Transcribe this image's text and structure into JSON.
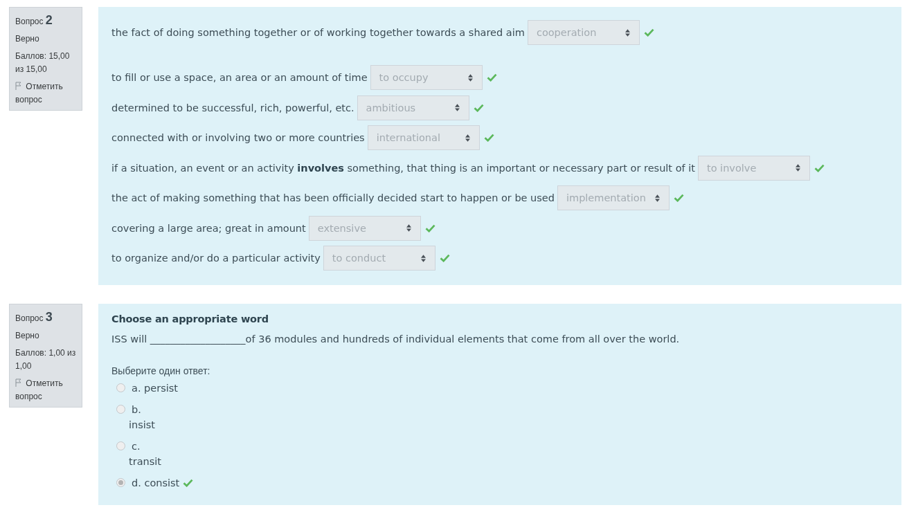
{
  "questions": [
    {
      "label": "Вопрос",
      "number": "2",
      "state": "Верно",
      "grade": "Баллов: 15,00 из 15,00",
      "flag_label": "Отметить вопрос",
      "kind": "matching",
      "disabled": true,
      "rows": [
        {
          "prompt": "the fact of doing something together or of working together towards a shared aim",
          "value": "cooperation",
          "correct": true
        },
        {
          "prompt": "to fill or use a space, an area or an amount of time",
          "value": "to occupy",
          "correct": true
        },
        {
          "prompt": "determined to be successful, rich, powerful, etc.",
          "value": "ambitious",
          "correct": true
        },
        {
          "prompt": "connected with or involving two or more countries",
          "value": "international",
          "correct": true
        },
        {
          "prompt": "if a situation, an event or an activity **involves** something, that thing is an important or necessary part or result of it",
          "value": "to involve",
          "correct": true
        },
        {
          "prompt": "the act of making something that has been officially decided start to happen or be used",
          "value": "implementation",
          "correct": true
        },
        {
          "prompt": "covering a large area; great in amount",
          "value": "extensive",
          "correct": true
        },
        {
          "prompt": "to organize and/or do a particular activity",
          "value": "to conduct",
          "correct": true
        }
      ]
    },
    {
      "label": "Вопрос",
      "number": "3",
      "state": "Верно",
      "grade": "Баллов: 1,00 из 1,00",
      "flag_label": "Отметить вопрос",
      "kind": "multichoice",
      "disabled": true,
      "title": "Choose an appropriate word",
      "text": "ISS will ___________________of 36 modules and hundreds of individual elements that come from all over the world.",
      "prompt": "Выберите один ответ:",
      "options": [
        {
          "kind": "inline",
          "letter": "a.",
          "text": "persist",
          "selected": false,
          "correct": false
        },
        {
          "kind": "stacked",
          "letter": "b.",
          "text": "insist",
          "selected": false,
          "correct": false
        },
        {
          "kind": "stacked",
          "letter": "c.",
          "text": "transit",
          "selected": false,
          "correct": false
        },
        {
          "kind": "inline",
          "letter": "d.",
          "text": "consist",
          "selected": true,
          "correct": true
        }
      ]
    }
  ]
}
